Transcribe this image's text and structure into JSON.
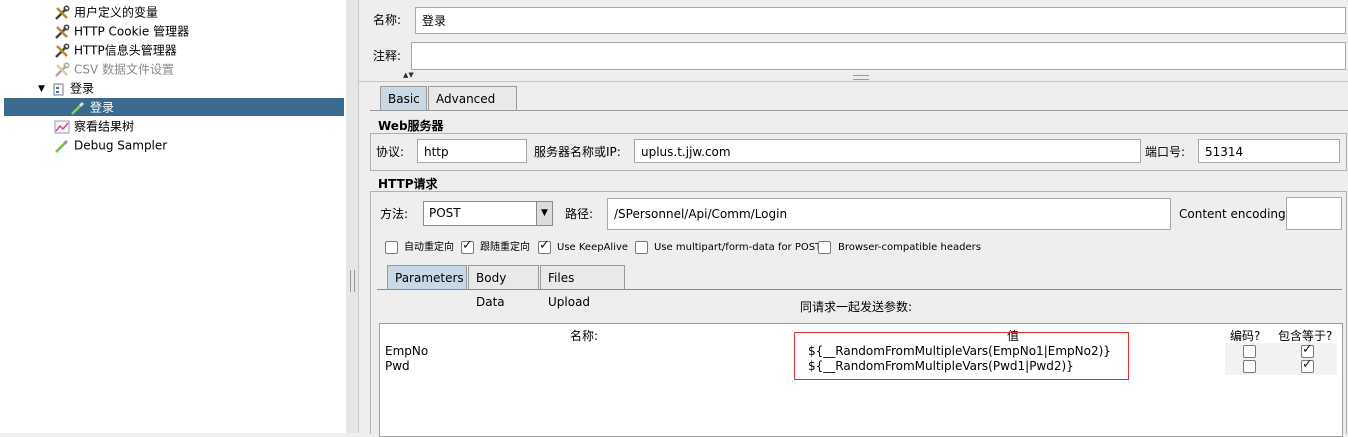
{
  "tree": {
    "items": [
      {
        "label": "用户定义的变量",
        "icon": "wrench-icon"
      },
      {
        "label": "HTTP Cookie 管理器",
        "icon": "wrench-icon"
      },
      {
        "label": "HTTP信息头管理器",
        "icon": "wrench-icon"
      },
      {
        "label": "CSV 数据文件设置",
        "icon": "wrench-icon"
      },
      {
        "label": "登录",
        "icon": "transaction-icon"
      },
      {
        "label": "登录",
        "icon": "sampler-pipette-icon"
      },
      {
        "label": "察看结果树",
        "icon": "chart-icon"
      },
      {
        "label": "Debug Sampler",
        "icon": "sampler-pipette-icon"
      }
    ],
    "selected_color": "#3a6b8f"
  },
  "form": {
    "name_label": "名称:",
    "name_value": "登录",
    "comment_label": "注释:",
    "comment_value": ""
  },
  "tabs": {
    "basic": "Basic",
    "advanced": "Advanced"
  },
  "web_server": {
    "title": "Web服务器",
    "protocol_label": "协议:",
    "protocol_value": "http",
    "server_label": "服务器名称或IP:",
    "server_value": "uplus.t.jjw.com",
    "port_label": "端口号:",
    "port_value": "51314"
  },
  "http_request": {
    "title": "HTTP请求",
    "method_label": "方法:",
    "method_value": "POST",
    "path_label": "路径:",
    "path_value": "/SPersonnel/Api/Comm/Login",
    "encoding_label": "Content encoding:",
    "encoding_value": ""
  },
  "options": [
    {
      "label": "自动重定向",
      "checked": false
    },
    {
      "label": "跟随重定向",
      "checked": true
    },
    {
      "label": "Use KeepAlive",
      "checked": true
    },
    {
      "label": "Use multipart/form-data for POST",
      "checked": false
    },
    {
      "label": "Browser-compatible headers",
      "checked": false
    }
  ],
  "sub_tabs": {
    "parameters": "Parameters",
    "body_data": "Body Data",
    "files_upload": "Files Upload"
  },
  "params": {
    "caption": "同请求一起发送参数:",
    "col_name": "名称:",
    "col_value": "值",
    "col_encode": "编码?",
    "col_include_equals": "包含等于?",
    "rows": [
      {
        "name": "EmpNo",
        "value": "${__RandomFromMultipleVars(EmpNo1|EmpNo2)}",
        "encode": false,
        "include_equals": true
      },
      {
        "name": "Pwd",
        "value": "${__RandomFromMultipleVars(Pwd1|Pwd2)}",
        "encode": false,
        "include_equals": true
      }
    ],
    "highlight_color": "#e0302f"
  }
}
